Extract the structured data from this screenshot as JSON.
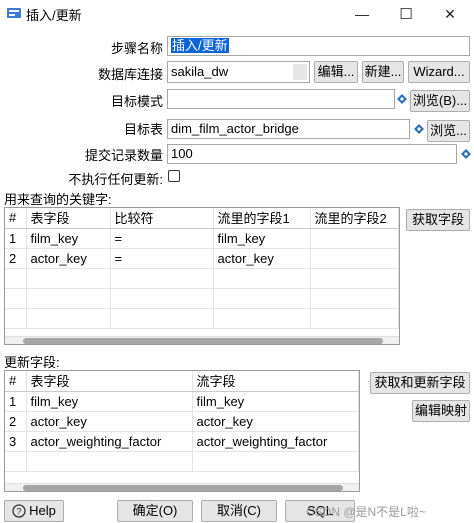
{
  "window": {
    "title": "插入/更新",
    "minimize_glyph": "—",
    "maximize_glyph": "☐",
    "close_glyph": "✕"
  },
  "form": {
    "step_name_label": "步骤名称",
    "step_name_value": "插入/更新",
    "db_conn_label": "数据库连接",
    "db_conn_value": "sakila_dw",
    "edit_button": "编辑...",
    "new_button": "新建...",
    "wizard_button": "Wizard...",
    "target_schema_label": "目标模式",
    "target_schema_value": "",
    "browse_b_button": "浏览(B)...",
    "target_table_label": "目标表",
    "target_table_value": "dim_film_actor_bridge",
    "browse_button": "浏览...",
    "commit_size_label": "提交记录数量",
    "commit_size_value": "100",
    "no_update_label": "不执行任何更新:"
  },
  "keys": {
    "section_label": "用来查询的关键字:",
    "get_fields_button": "获取字段",
    "columns": [
      "#",
      "表字段",
      "比较符",
      "流里的字段1",
      "流里的字段2"
    ],
    "rows": [
      [
        "1",
        "film_key",
        "=",
        "film_key",
        ""
      ],
      [
        "2",
        "actor_key",
        "=",
        "actor_key",
        ""
      ]
    ]
  },
  "update": {
    "section_label": "更新字段:",
    "get_update_fields_button": "获取和更新字段",
    "edit_mapping_button": "编辑映射",
    "columns": [
      "#",
      "表字段",
      "流字段"
    ],
    "rows": [
      [
        "1",
        "film_key",
        "film_key"
      ],
      [
        "2",
        "actor_key",
        "actor_key"
      ],
      [
        "3",
        "actor_weighting_factor",
        "actor_weighting_factor"
      ]
    ]
  },
  "footer": {
    "help_button": "Help",
    "ok_button": "确定(O)",
    "cancel_button": "取消(C)",
    "sql_button": "SQL",
    "watermark": "CSDN @是N不是L啦~"
  },
  "colors": {
    "selection": "#0a64d8",
    "button_bg": "#e5e5e5",
    "border": "#a8a8a8"
  }
}
